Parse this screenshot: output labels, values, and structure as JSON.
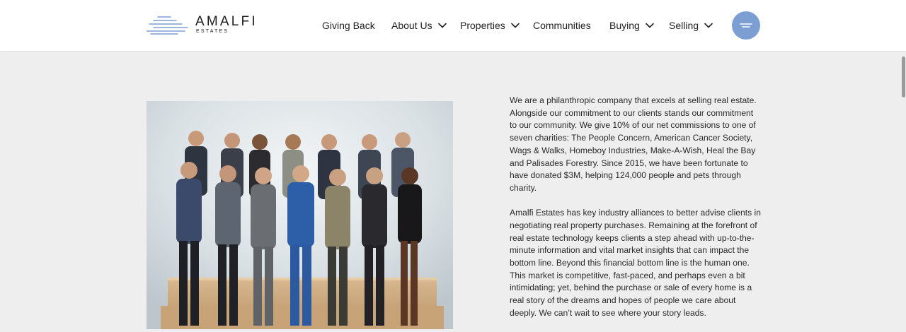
{
  "header": {
    "logo": {
      "wordmark": "AMALFI",
      "subtitle": "ESTATES",
      "mark_color": "#7d9ed3"
    },
    "nav": [
      {
        "label": "Giving Back",
        "has_dropdown": false
      },
      {
        "label": "About Us",
        "has_dropdown": true
      },
      {
        "label": "Properties",
        "has_dropdown": true
      },
      {
        "label": "Communities",
        "has_dropdown": false
      },
      {
        "label": "Buying",
        "has_dropdown": true
      },
      {
        "label": "Selling",
        "has_dropdown": true
      }
    ],
    "menu_button": {
      "icon": "hamburger-icon",
      "color": "#7d9ed3"
    }
  },
  "main": {
    "photo": {
      "subject": "team-photo"
    },
    "paragraphs": [
      "We are a philanthropic company that excels at selling real estate. Alongside our commitment to our clients stands our commitment to our community. We give 10% of our net commissions to one of seven charities: The People Concern, American Cancer Society, Wags & Walks, Homeboy Industries, Make-A-Wish, Heal the Bay and Palisades Forestry. Since 2015, we have been fortunate to have donated $3M, helping 124,000 people and pets through charity.",
      "Amalfi Estates has key industry alliances to better advise clients in negotiating real property purchases. Remaining at the forefront of real estate technology keeps clients a step ahead with up-to-the-minute information and vital market insights that can impact the bottom line. Beyond this financial bottom line is the human one. This market is competitive, fast-paced, and perhaps even a bit intimidating; yet, behind the purchase or sale of every home is a real story of the dreams and hopes of people we care about deeply. We can’t wait to see where your story leads."
    ]
  },
  "colors": {
    "background": "#eeeeee",
    "header": "#ffffff",
    "accent": "#7d9ed3",
    "text": "#222222"
  }
}
